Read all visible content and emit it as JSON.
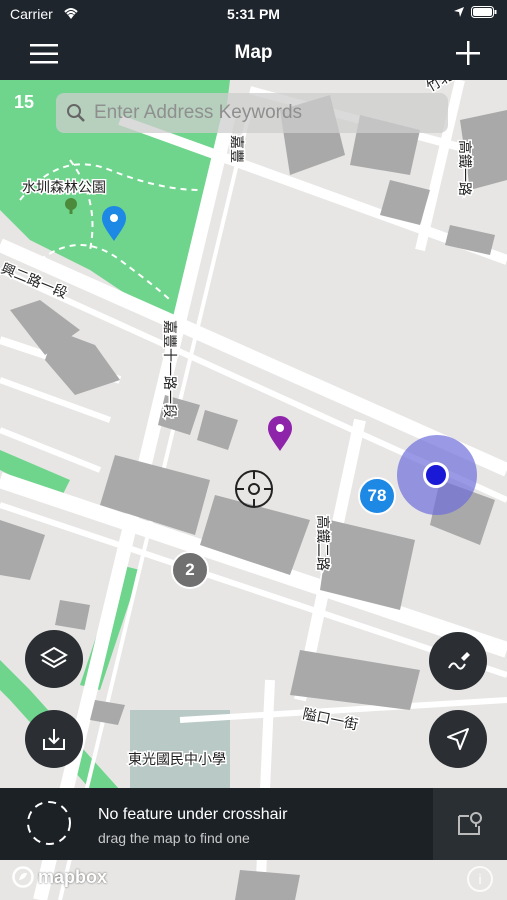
{
  "status_bar": {
    "carrier": "Carrier",
    "time": "5:31 PM"
  },
  "nav": {
    "title": "Map",
    "menu_icon": "hamburger-menu-icon",
    "add_icon": "plus-icon"
  },
  "map": {
    "zoom_level": "15",
    "search": {
      "placeholder": "Enter Address Keywords"
    },
    "labels": {
      "park": "水圳森林公園",
      "road_a": "興二路一段",
      "road_b": "嘉豐十一路一段",
      "road_c": "高鐵一路",
      "road_d": "高鐵二路",
      "road_e": "隘口一街",
      "school": "東光國民中小學",
      "road_f": "竹北六路",
      "road_g": "嘉豐"
    },
    "clusters": [
      {
        "count": "78",
        "color": "#1e88e5"
      },
      {
        "count": "2",
        "color": "#707070"
      }
    ],
    "markers": [
      {
        "name": "blue-pin",
        "color": "#1e88e5"
      },
      {
        "name": "purple-pin",
        "color": "#8e24aa"
      }
    ],
    "location_dot_color": "#1a1ad6"
  },
  "bottom_panel": {
    "message": "No feature under crosshair",
    "hint": "drag the map to find one"
  },
  "attribution": {
    "brand": "mapbox",
    "info": "i"
  }
}
